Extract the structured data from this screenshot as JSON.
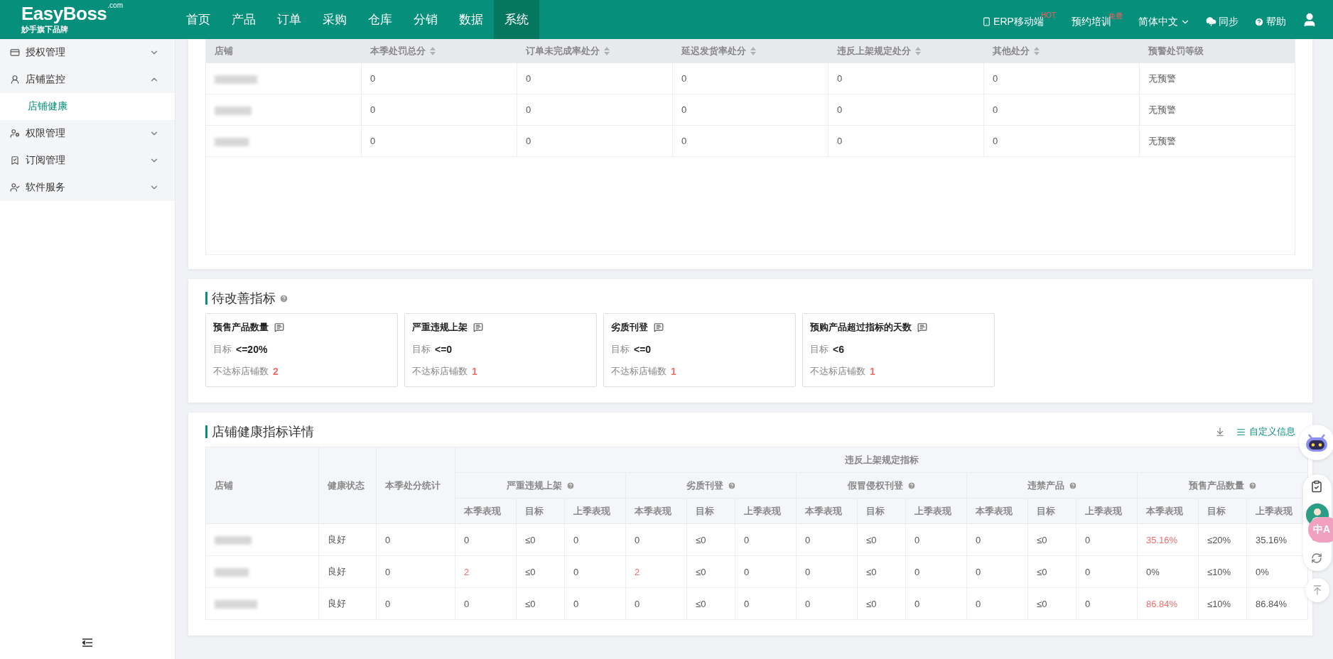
{
  "header": {
    "logo": "EasyBoss",
    "logo_suffix": ".com",
    "tagline": "妙手旗下品牌",
    "nav": [
      {
        "label": "首页",
        "selected": false
      },
      {
        "label": "产品",
        "selected": false
      },
      {
        "label": "订单",
        "selected": false
      },
      {
        "label": "采购",
        "selected": false
      },
      {
        "label": "仓库",
        "selected": false
      },
      {
        "label": "分销",
        "selected": false
      },
      {
        "label": "数据",
        "selected": false
      },
      {
        "label": "系统",
        "selected": true
      }
    ],
    "actions": [
      {
        "kind": "mobile",
        "label": "ERP移动端",
        "badge": "HOT"
      },
      {
        "kind": "plain",
        "label": "预约培训",
        "badge": "免费"
      },
      {
        "kind": "dropdown",
        "label": "简体中文"
      },
      {
        "kind": "sync",
        "label": "同步"
      },
      {
        "kind": "help",
        "label": "帮助"
      }
    ]
  },
  "sidebar": {
    "items": [
      {
        "label": "授权管理",
        "expanded": false
      },
      {
        "label": "店铺监控",
        "expanded": true,
        "children": [
          {
            "label": "店铺健康",
            "selected": true
          }
        ]
      },
      {
        "label": "权限管理",
        "expanded": false
      },
      {
        "label": "订阅管理",
        "expanded": false
      },
      {
        "label": "软件服务",
        "expanded": false
      }
    ]
  },
  "penalty_table": {
    "columns": [
      {
        "label": "店铺",
        "sortable": false
      },
      {
        "label": "本季处罚总分",
        "sortable": true
      },
      {
        "label": "订单未完成率处分",
        "sortable": true
      },
      {
        "label": "延迟发货率处分",
        "sortable": true
      },
      {
        "label": "违反上架规定处分",
        "sortable": true
      },
      {
        "label": "其他处分",
        "sortable": true
      },
      {
        "label": "预警处罚等级",
        "sortable": false
      }
    ],
    "rows": [
      {
        "cells": [
          "",
          "0",
          "0",
          "0",
          "0",
          "0",
          "无预警"
        ]
      },
      {
        "cells": [
          "",
          "0",
          "0",
          "0",
          "0",
          "0",
          "无预警"
        ]
      },
      {
        "cells": [
          "",
          "0",
          "0",
          "0",
          "0",
          "0",
          "无预警"
        ]
      }
    ]
  },
  "improve": {
    "title": "待改善指标",
    "cards": [
      {
        "title": "预售产品数量",
        "target_label": "目标",
        "target": "<=20%",
        "fail_label": "不达标店铺数",
        "fail_count": "2"
      },
      {
        "title": "严重违规上架",
        "target_label": "目标",
        "target": "<=0",
        "fail_label": "不达标店铺数",
        "fail_count": "1"
      },
      {
        "title": "劣质刊登",
        "target_label": "目标",
        "target": "<=0",
        "fail_label": "不达标店铺数",
        "fail_count": "1"
      },
      {
        "title": "预购产品超过指标的天数",
        "target_label": "目标",
        "target": "<6",
        "fail_label": "不达标店铺数",
        "fail_count": "1"
      }
    ]
  },
  "detail": {
    "title": "店铺健康指标详情",
    "custom_link": "自定义信息",
    "fixed_columns": [
      "店铺",
      "健康状态",
      "本季处分统计"
    ],
    "group_title": "违反上架规定指标",
    "groups": [
      {
        "name": "严重违规上架",
        "sub": [
          "本季表现",
          "目标",
          "上季表现"
        ]
      },
      {
        "name": "劣质刊登",
        "sub": [
          "本季表现",
          "目标",
          "上季表现"
        ]
      },
      {
        "name": "假冒侵权刊登",
        "sub": [
          "本季表现",
          "目标",
          "上季表现"
        ]
      },
      {
        "name": "违禁产品",
        "sub": [
          "本季表现",
          "目标",
          "上季表现"
        ]
      },
      {
        "name": "预售产品数量",
        "sub": [
          "本季表现",
          "目标",
          "上季表现"
        ]
      }
    ],
    "rows": [
      {
        "status": "良好",
        "total": "0",
        "values": [
          {
            "text": "0",
            "alert": false
          },
          {
            "text": "≤0",
            "alert": false
          },
          {
            "text": "0",
            "alert": false
          },
          {
            "text": "0",
            "alert": false
          },
          {
            "text": "≤0",
            "alert": false
          },
          {
            "text": "0",
            "alert": false
          },
          {
            "text": "0",
            "alert": false
          },
          {
            "text": "≤0",
            "alert": false
          },
          {
            "text": "0",
            "alert": false
          },
          {
            "text": "0",
            "alert": false
          },
          {
            "text": "≤0",
            "alert": false
          },
          {
            "text": "0",
            "alert": false
          },
          {
            "text": "35.16%",
            "alert": true
          },
          {
            "text": "≤20%",
            "alert": false
          },
          {
            "text": "35.16%",
            "alert": false
          }
        ]
      },
      {
        "status": "良好",
        "total": "0",
        "values": [
          {
            "text": "2",
            "alert": true
          },
          {
            "text": "≤0",
            "alert": false
          },
          {
            "text": "0",
            "alert": false
          },
          {
            "text": "2",
            "alert": true
          },
          {
            "text": "≤0",
            "alert": false
          },
          {
            "text": "0",
            "alert": false
          },
          {
            "text": "0",
            "alert": false
          },
          {
            "text": "≤0",
            "alert": false
          },
          {
            "text": "0",
            "alert": false
          },
          {
            "text": "0",
            "alert": false
          },
          {
            "text": "≤0",
            "alert": false
          },
          {
            "text": "0",
            "alert": false
          },
          {
            "text": "0%",
            "alert": false
          },
          {
            "text": "≤10%",
            "alert": false
          },
          {
            "text": "0%",
            "alert": false
          }
        ]
      },
      {
        "status": "良好",
        "total": "0",
        "values": [
          {
            "text": "0",
            "alert": false
          },
          {
            "text": "≤0",
            "alert": false
          },
          {
            "text": "0",
            "alert": false
          },
          {
            "text": "0",
            "alert": false
          },
          {
            "text": "≤0",
            "alert": false
          },
          {
            "text": "0",
            "alert": false
          },
          {
            "text": "0",
            "alert": false
          },
          {
            "text": "≤0",
            "alert": false
          },
          {
            "text": "0",
            "alert": false
          },
          {
            "text": "0",
            "alert": false
          },
          {
            "text": "≤0",
            "alert": false
          },
          {
            "text": "0",
            "alert": false
          },
          {
            "text": "86.84%",
            "alert": true
          },
          {
            "text": "≤10%",
            "alert": false
          },
          {
            "text": "86.84%",
            "alert": false
          }
        ]
      }
    ]
  },
  "float_tools": {
    "translate_badge": "中A"
  }
}
